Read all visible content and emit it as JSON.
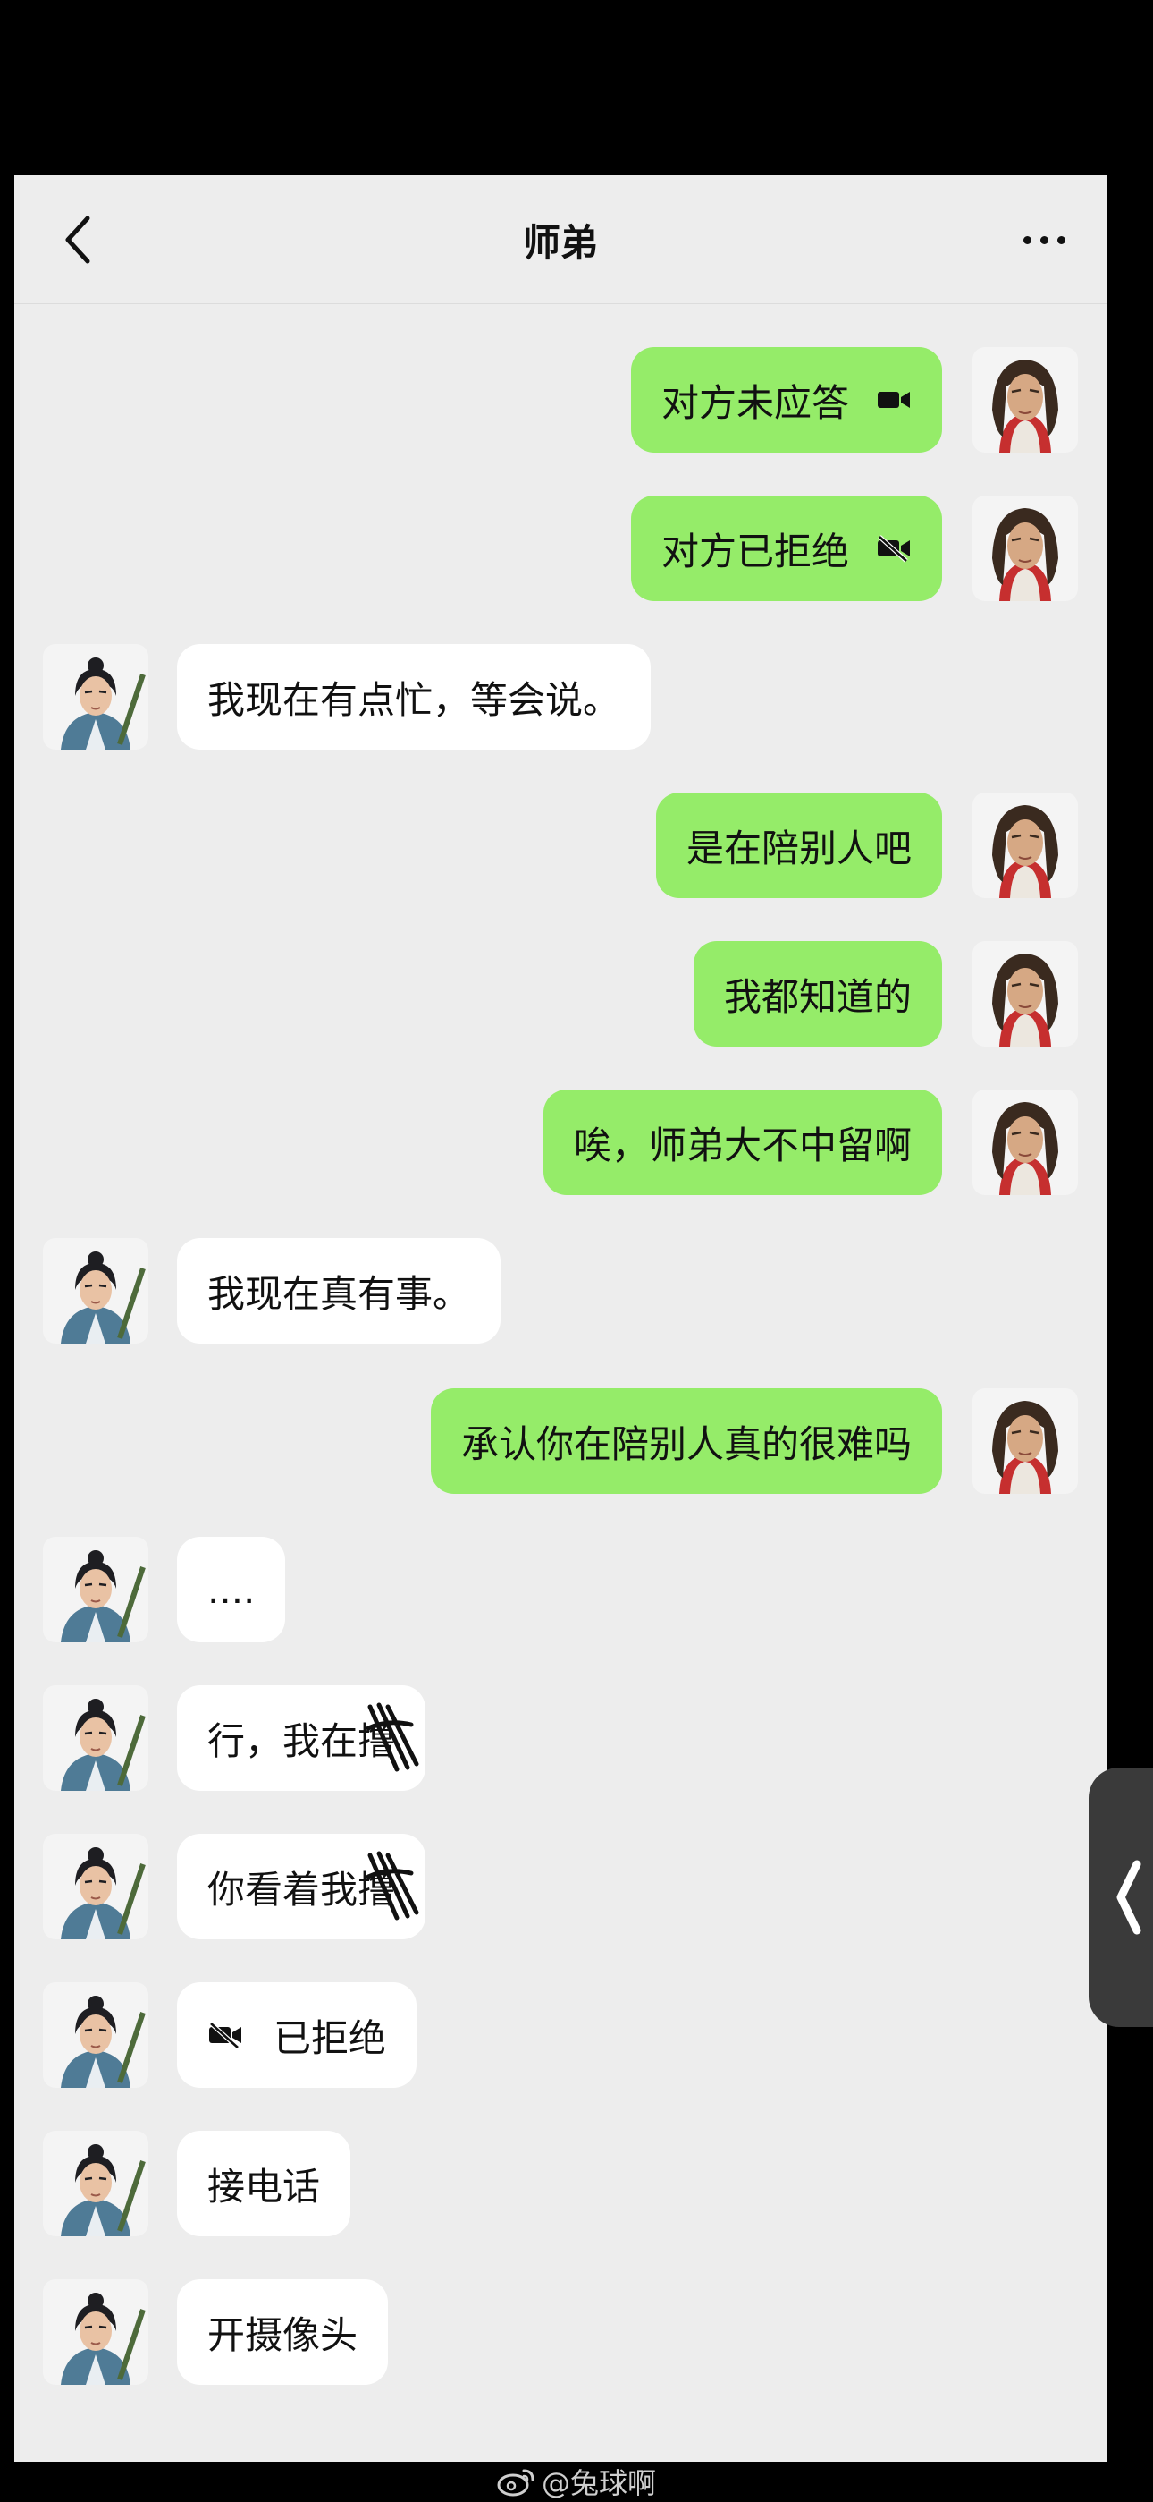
{
  "header": {
    "title": "师弟"
  },
  "icons": {
    "back": "chevron-left-icon",
    "more": "more-dots-icon",
    "video": "video-camera-icon",
    "video_off": "video-camera-off-icon",
    "side_tab": "chevron-left-icon",
    "watermark": "weibo-icon"
  },
  "messages": [
    {
      "from": "me",
      "text": "对方未应答",
      "icon": "video-camera-icon"
    },
    {
      "from": "me",
      "text": "对方已拒绝",
      "icon": "video-camera-off-icon"
    },
    {
      "from": "them",
      "text": "我现在有点忙，等会说。"
    },
    {
      "from": "me",
      "text": "是在陪别人吧"
    },
    {
      "from": "me",
      "text": "我都知道的"
    },
    {
      "from": "me",
      "text": "唉，师弟大不中留啊"
    },
    {
      "from": "them",
      "text": "我现在真有事。"
    },
    {
      "from": "me",
      "text": "承认你在陪别人真的很难吗"
    },
    {
      "from": "them",
      "text": "...."
    },
    {
      "from": "them",
      "text": "行，我在撸"
    },
    {
      "from": "them",
      "text": "你看着我撸"
    },
    {
      "from": "them",
      "text": "已拒绝",
      "icon": "video-camera-off-icon"
    },
    {
      "from": "them",
      "text": "接电话"
    },
    {
      "from": "them",
      "text": "开摄像头"
    }
  ],
  "watermark": {
    "text": "@兔球啊"
  },
  "colors": {
    "background": "#ededed",
    "me_bubble": "#95ec69",
    "them_bubble": "#ffffff",
    "outer": "#000000"
  }
}
